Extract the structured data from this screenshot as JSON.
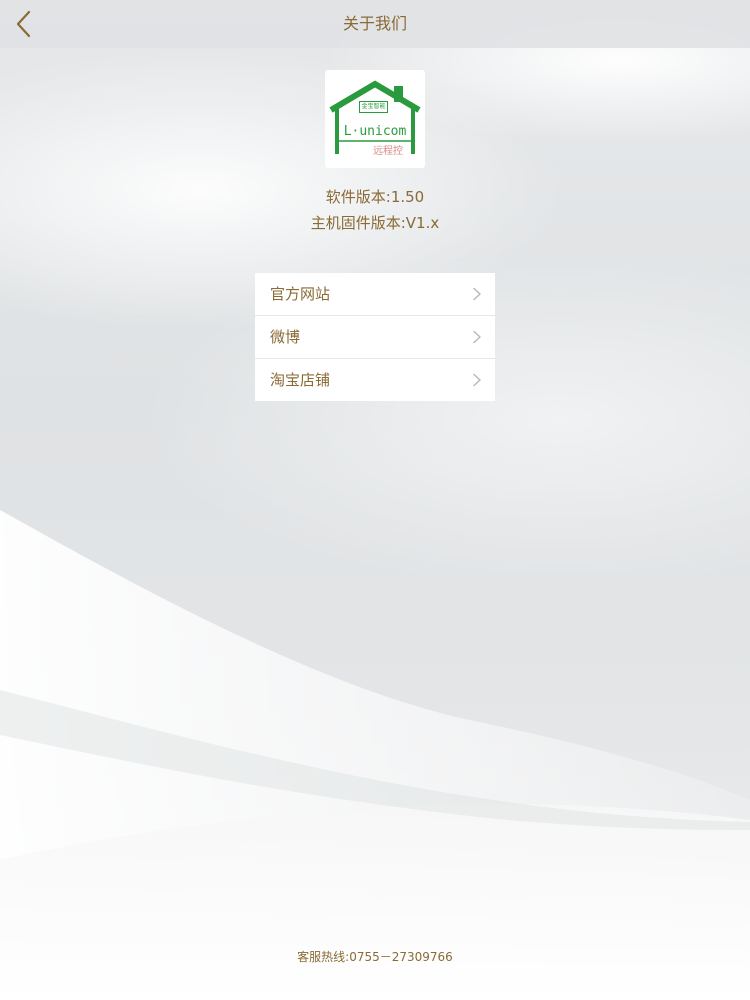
{
  "header": {
    "title": "关于我们",
    "back_icon": "chevron-left-icon"
  },
  "logo": {
    "badge_text": "金宝智能",
    "brand": "L·unicom",
    "sub": "远程控",
    "colors": {
      "green": "#2a9a3e",
      "pink": "#d98a8a"
    }
  },
  "versions": {
    "software": "软件版本:1.50",
    "firmware": "主机固件版本:V1.x"
  },
  "menu": {
    "items": [
      {
        "label": "官方网站",
        "icon": "chevron-right-icon"
      },
      {
        "label": "微博",
        "icon": "chevron-right-icon"
      },
      {
        "label": "淘宝店铺",
        "icon": "chevron-right-icon"
      }
    ]
  },
  "footer": {
    "hotline": "客服热线:0755－27309766"
  },
  "colors": {
    "accent_text": "#8a6a35",
    "navbar_bg": "#e1e2e4",
    "card_bg": "#ffffff"
  }
}
